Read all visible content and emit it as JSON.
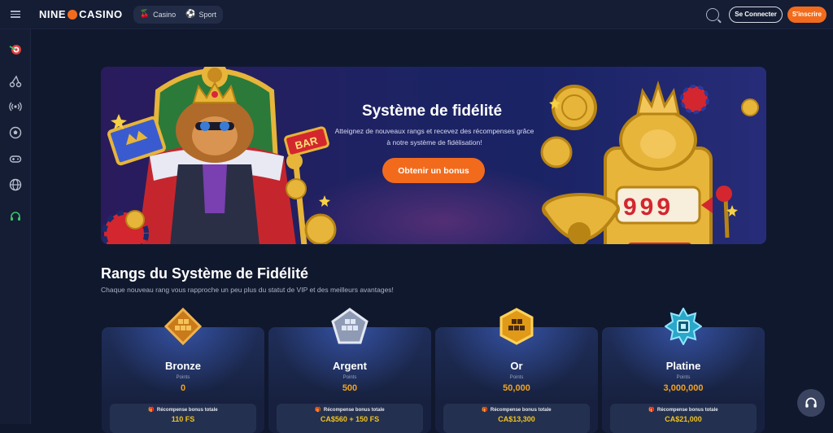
{
  "header": {
    "logo_left": "NINE",
    "logo_right": "CASINO",
    "mode_casino": "Casino",
    "mode_sport": "Sport",
    "login_label": "Se Connecter",
    "signup_label": "S'inscrire"
  },
  "sidebar": {
    "icons": [
      "darts-icon",
      "cherries-icon",
      "live-broadcast-icon",
      "football-icon",
      "gamepad-icon",
      "globe-icon",
      "support-headset-icon"
    ]
  },
  "banner": {
    "title": "Système de fidélité",
    "subtitle_line1": "Atteignez de nouveaux rangs et recevez des récompenses grâce",
    "subtitle_line2": "à notre système de fidélisation!",
    "cta": "Obtenir un bonus",
    "slot_digits": "999",
    "bar_sign": "BAR"
  },
  "ranks": {
    "title": "Rangs du Système de Fidélité",
    "subtitle": "Chaque nouveau rang vous rapproche un peu plus du statut de VIP et des meilleurs avantages!",
    "points_label": "Points",
    "reward_label": "Récompense bonus totale",
    "items": [
      {
        "name": "Bronze",
        "points": "0",
        "reward": "110 FS"
      },
      {
        "name": "Argent",
        "points": "500",
        "reward": "CA$560 + 150 FS"
      },
      {
        "name": "Or",
        "points": "50,000",
        "reward": "CA$13,300"
      },
      {
        "name": "Platine",
        "points": "3,000,000",
        "reward": "CA$21,000"
      }
    ]
  },
  "colors": {
    "accent": "#f26b1d",
    "background": "#10182e",
    "points": "#f2a31d",
    "reward": "#f2c31d"
  }
}
